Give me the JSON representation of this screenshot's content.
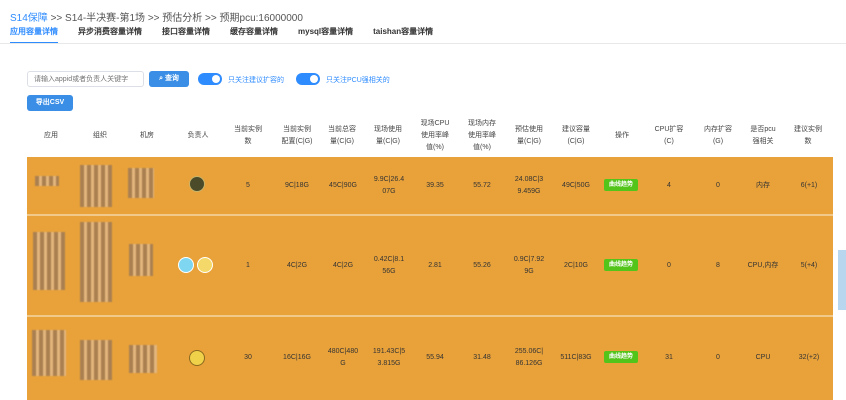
{
  "breadcrumb": {
    "root": "S14保障",
    "path": " >> S14-半决赛-第1场 >> 预估分析 >> 预期pcu:16000000"
  },
  "tabs": [
    {
      "label": "应用容量详情",
      "active": true
    },
    {
      "label": "异步消费容量详情"
    },
    {
      "label": "接口容量详情"
    },
    {
      "label": "缓存容量详情"
    },
    {
      "label": "mysql容量详情"
    },
    {
      "label": "taishan容量详情"
    }
  ],
  "toolbar": {
    "search_placeholder": "请输入appid或者负责人关键字",
    "query_label": "查询",
    "toggle1_label": "只关注建议扩容的",
    "toggle2_label": "只关注PCU强相关的",
    "export_label": "导出CSV"
  },
  "columns": [
    "应用",
    "组织",
    "机房",
    "负责人",
    "当前实例\n数",
    "当前实例\n配置(C|G)",
    "当前总容\n量(C|G)",
    "现场使用\n量(C|G)",
    "现场CPU\n使用率峰\n值(%)",
    "现场内存\n使用率峰\n值(%)",
    "预估使用\n量(C|G)",
    "建议容量\n(C|G)",
    "操作",
    "CPU扩容\n(C)",
    "内存扩容\n(G)",
    "是否pcu\n强相关",
    "建议实例\n数"
  ],
  "rows": [
    {
      "instances": "5",
      "config": "9C|18G",
      "total": "45C|90G",
      "used": "9.9C|26.4\n07G",
      "cpu_peak": "39.35",
      "mem_peak": "55.72",
      "est": "24.08C|3\n9.459G",
      "suggest": "49C|50G",
      "action": "曲线趋势",
      "cpu_exp": "4",
      "mem_exp": "0",
      "pcu": "内存",
      "suggest_inst": "6(+1)"
    },
    {
      "instances": "1",
      "config": "4C|2G",
      "total": "4C|2G",
      "used": "0.42C|8.1\n56G",
      "cpu_peak": "2.81",
      "mem_peak": "55.26",
      "est": "0.9C|7.92\n9G",
      "suggest": "2C|10G",
      "action": "曲线趋势",
      "cpu_exp": "0",
      "mem_exp": "8",
      "pcu": "CPU,内存",
      "suggest_inst": "5(+4)"
    },
    {
      "instances": "30",
      "config": "16C|16G",
      "total": "480C|480\nG",
      "used": "191.43C|5\n3.815G",
      "cpu_peak": "55.94",
      "mem_peak": "31.48",
      "est": "255.06C|\n86.126G",
      "suggest": "511C|83G",
      "action": "曲线趋势",
      "cpu_exp": "31",
      "mem_exp": "0",
      "pcu": "CPU",
      "suggest_inst": "32(+2)"
    }
  ],
  "colors": {
    "accent": "#2f8cff",
    "row_highlight": "#e9a23a",
    "badge": "#52c41a"
  }
}
